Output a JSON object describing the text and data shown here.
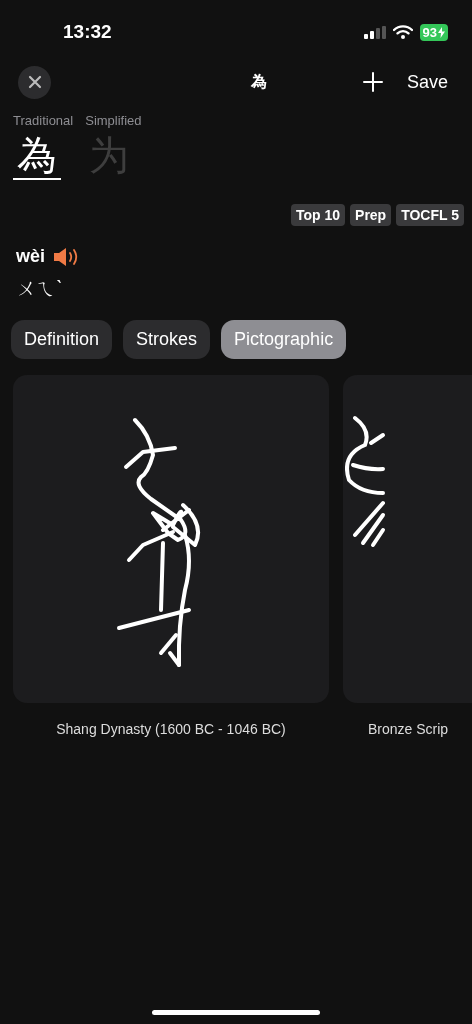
{
  "status_bar": {
    "time": "13:32",
    "battery": "93"
  },
  "nav": {
    "title": "為",
    "save": "Save"
  },
  "scripts": [
    {
      "label": "Traditional",
      "char": "為",
      "selected": true
    },
    {
      "label": "Simplified",
      "char": "为",
      "selected": false
    }
  ],
  "tags": [
    "Top 10",
    "Prep",
    "TOCFL 5"
  ],
  "pinyin": "wèi",
  "zhuyin": "ㄨㄟˋ",
  "tabs": [
    {
      "label": "Definition",
      "selected": false
    },
    {
      "label": "Strokes",
      "selected": false
    },
    {
      "label": "Pictographic",
      "selected": true
    }
  ],
  "forms": [
    {
      "kind": "oracle",
      "caption": "Shang Dynasty (1600 BC - 1046 BC)"
    },
    {
      "kind": "bronze",
      "caption": "Bronze Scrip"
    }
  ]
}
